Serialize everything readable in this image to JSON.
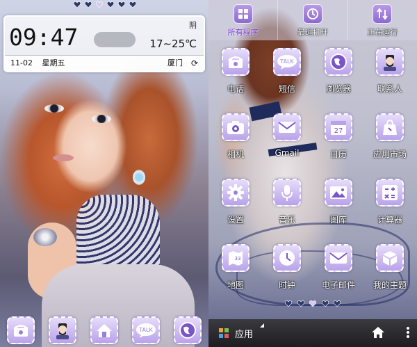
{
  "left_screen": {
    "page_dots": [
      "dot-1",
      "dot-2",
      "dot-3",
      "dot-4",
      "dot-5",
      "dot-6"
    ],
    "active_dot": 3,
    "weather_widget": {
      "time": "09:47",
      "condition": "阴",
      "temperature": "17~25℃",
      "date": "11-02",
      "weekday": "星期五",
      "city": "厦门",
      "refresh_symbol": "⟳"
    },
    "dock": [
      {
        "name": "phone",
        "icon": "telephone-icon"
      },
      {
        "name": "contacts",
        "icon": "person-icon"
      },
      {
        "name": "home",
        "icon": "house-icon"
      },
      {
        "name": "messages",
        "icon": "talk-bubble-icon"
      },
      {
        "name": "browser",
        "icon": "globe-icon"
      }
    ]
  },
  "right_screen": {
    "top_tabs": [
      {
        "label": "所有程序",
        "icon": "grid-icon",
        "active": true
      },
      {
        "label": "最近打开",
        "icon": "clock-icon",
        "active": false
      },
      {
        "label": "正在运行",
        "icon": "sort-arrows-icon",
        "active": false
      }
    ],
    "apps": [
      [
        {
          "label": "电话",
          "icon": "telephone-icon"
        },
        {
          "label": "短信",
          "icon": "talk-bubble-icon"
        },
        {
          "label": "浏览器",
          "icon": "globe-icon"
        },
        {
          "label": "联系人",
          "icon": "person-icon"
        }
      ],
      [
        {
          "label": "相机",
          "icon": "camera-icon"
        },
        {
          "label": "Gmail",
          "icon": "envelope-icon"
        },
        {
          "label": "日历",
          "icon": "calendar-icon"
        },
        {
          "label": "应用市场",
          "icon": "shopping-bag-icon"
        }
      ],
      [
        {
          "label": "设置",
          "icon": "gear-icon"
        },
        {
          "label": "音乐",
          "icon": "microphone-icon"
        },
        {
          "label": "图库",
          "icon": "picture-icon"
        },
        {
          "label": "计算器",
          "icon": "calculator-icon"
        }
      ],
      [
        {
          "label": "地图",
          "icon": "map-icon"
        },
        {
          "label": "时钟",
          "icon": "clock-icon"
        },
        {
          "label": "电子邮件",
          "icon": "envelope-icon"
        },
        {
          "label": "我的主题",
          "icon": "box-icon"
        }
      ]
    ],
    "calendar_day": "27",
    "sms_badge": "TALK",
    "map_badge": "33",
    "page_dots": [
      "dot-1",
      "dot-2",
      "dot-3",
      "dot-4",
      "dot-5"
    ],
    "active_dot": 3,
    "nav": {
      "launcher_label": "应用",
      "home_icon": "house-icon",
      "menu_icon": "overflow-menu-icon"
    },
    "colors": {
      "accent": "#8d69cf",
      "tile_light": "#e6dcfa",
      "active_tab": "#7a3fd4",
      "navbar": "#1d1d21"
    }
  }
}
